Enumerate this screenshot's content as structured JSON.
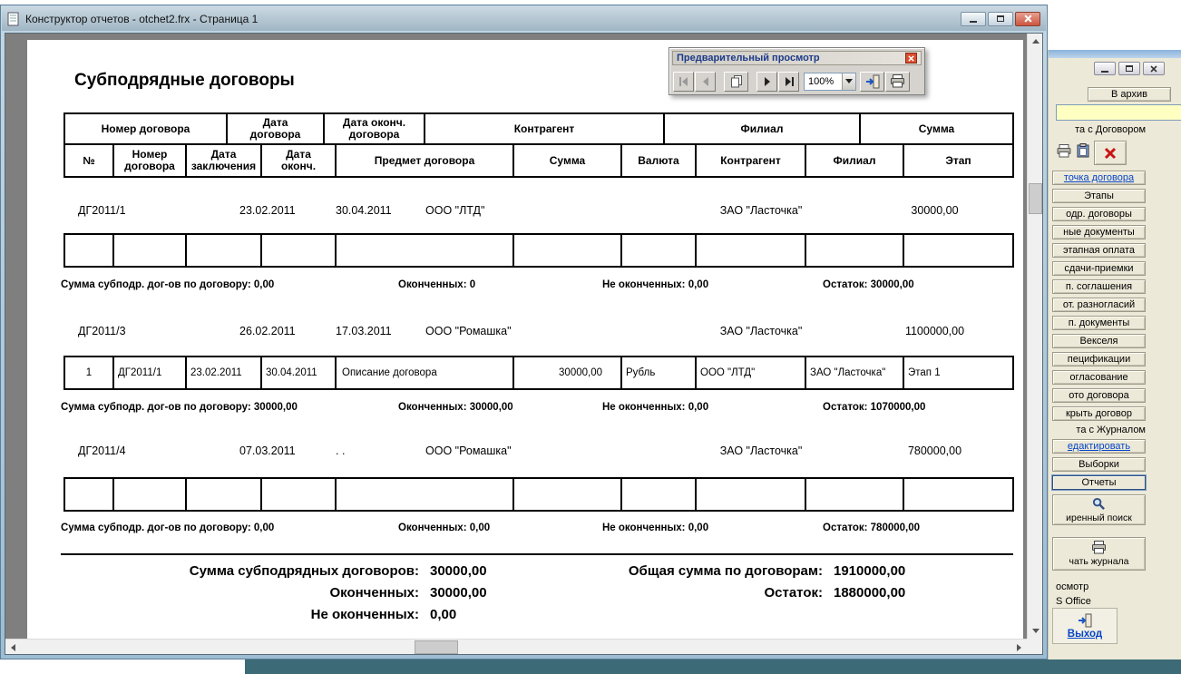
{
  "main_window": {
    "title": "Конструктор отчетов - otchet2.frx - Страница 1"
  },
  "preview_toolbar": {
    "title": "Предварительный просмотр",
    "zoom_value": "100%"
  },
  "report": {
    "title": "Субподрядные договоры",
    "header_row1": [
      "Номер договора",
      "Дата\nдоговора",
      "Дата оконч.\nдоговора",
      "Контрагент",
      "Филиал",
      "Сумма"
    ],
    "header_row2": [
      "№",
      "Номер\nдоговора",
      "Дата\nзаключения",
      "Дата\nоконч.",
      "Предмет договора",
      "Сумма",
      "Валюта",
      "Контрагент",
      "Филиал",
      "Этап"
    ],
    "groups": [
      {
        "contract": "ДГ2011/1",
        "date": "23.02.2011",
        "end_date": "30.04.2011",
        "contragent": "ООО \"ЛТД\"",
        "filial": "ЗАО \"Ласточка\"",
        "sum": "30000,00",
        "detail": [
          "",
          "",
          "",
          "",
          "",
          "",
          "",
          "",
          "",
          ""
        ],
        "summary": [
          "Сумма субподр. дог-ов по договору: 0,00",
          "Оконченных: 0",
          "Не оконченных: 0,00",
          "Остаток: 30000,00"
        ]
      },
      {
        "contract": "ДГ2011/3",
        "date": "26.02.2011",
        "end_date": "17.03.2011",
        "contragent": "ООО \"Ромашка\"",
        "filial": "ЗАО \"Ласточка\"",
        "sum": "1100000,00",
        "detail": [
          "1",
          "ДГ2011/1",
          "23.02.2011",
          "30.04.2011",
          "Описание договора",
          "30000,00",
          "Рубль",
          "ООО \"ЛТД\"",
          "ЗАО \"Ласточка\"",
          "Этап 1"
        ],
        "summary": [
          "Сумма субподр. дог-ов по договору: 30000,00",
          "Оконченных: 30000,00",
          "Не оконченных: 0,00",
          "Остаток: 1070000,00"
        ]
      },
      {
        "contract": "ДГ2011/4",
        "date": "07.03.2011",
        "end_date": ". .",
        "contragent": "ООО \"Ромашка\"",
        "filial": "ЗАО \"Ласточка\"",
        "sum": "780000,00",
        "detail": [
          "",
          "",
          "",
          "",
          "",
          "",
          "",
          "",
          "",
          ""
        ],
        "summary": [
          "Сумма субподр. дог-ов по договору: 0,00",
          "Оконченных: 0,00",
          "Не оконченных: 0,00",
          "Остаток: 780000,00"
        ]
      }
    ],
    "totals": {
      "rows": [
        {
          "left_label": "Сумма субподрядных договоров:",
          "left_value": "30000,00",
          "right_label": "Общая сумма по договорам:",
          "right_value": "1910000,00"
        },
        {
          "left_label": "Оконченных:",
          "left_value": "30000,00",
          "right_label": "Остаток:",
          "right_value": "1880000,00"
        },
        {
          "left_label": "Не оконченных:",
          "left_value": "0,00",
          "right_label": "",
          "right_value": ""
        }
      ]
    }
  },
  "side_panel": {
    "archive_button": "В архив",
    "group_contract_label": "та с Договором",
    "contract_buttons": [
      "точка договора",
      "Этапы",
      "одр. договоры",
      "ные документы",
      "этапная оплата",
      "сдачи-приемки",
      "п. соглашения",
      "от. разногласий",
      "п. документы",
      "Векселя",
      "пецификации",
      "огласование",
      "ото договора",
      "крыть договор"
    ],
    "group_journal_label": "та с Журналом",
    "journal_buttons": [
      "едактировать",
      "Выборки",
      "Отчеты"
    ],
    "search_button_label": "иренный поиск",
    "print_button_label": "чать журнала",
    "preview_label": "осмотр",
    "office_label": "S Office",
    "exit_label": "Выход"
  }
}
